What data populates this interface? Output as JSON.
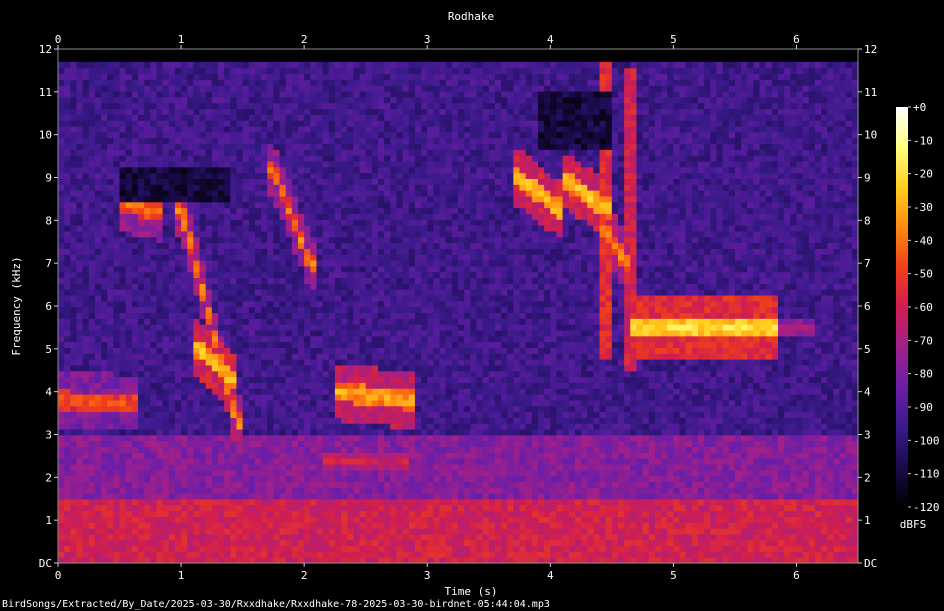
{
  "chart_data": {
    "type": "heatmap",
    "title": "Rodhake",
    "xlabel": "Time (s)",
    "ylabel": "Frequency (kHz)",
    "xlim": [
      0,
      6.5
    ],
    "ylim": [
      0,
      12
    ],
    "x_ticks": [
      "0",
      "1",
      "2",
      "3",
      "4",
      "5",
      "6"
    ],
    "y_ticks": [
      "DC",
      "1",
      "2",
      "3",
      "4",
      "5",
      "6",
      "7",
      "8",
      "9",
      "10",
      "11",
      "12"
    ],
    "colorbar": {
      "label": "dBFS",
      "range": [
        -120,
        0
      ],
      "ticks": [
        "+0",
        "-10",
        "-20",
        "-30",
        "-40",
        "-50",
        "-60",
        "-70",
        "-80",
        "-90",
        "-100",
        "-110",
        "-120"
      ]
    },
    "colormap": [
      "#000000",
      "#1a0a4a",
      "#3a1a8a",
      "#6a1ea8",
      "#a0208a",
      "#d01e50",
      "#f04018",
      "#ff8a10",
      "#ffd020",
      "#ffff80",
      "#ffffff"
    ],
    "background_level_db": -95,
    "low_freq_energy": [
      {
        "f0": 0,
        "f1": 1.5,
        "db": -60
      },
      {
        "f0": 1.5,
        "f1": 3.0,
        "db": -78
      }
    ],
    "features": [
      {
        "kind": "tone",
        "t0": 0.0,
        "t1": 0.6,
        "f0": 3.8,
        "f1": 3.75,
        "db": -45
      },
      {
        "kind": "sweep",
        "t0": 0.55,
        "t1": 0.8,
        "f0": 8.4,
        "f1": 8.2,
        "db": -40
      },
      {
        "kind": "sweep",
        "t0": 1.0,
        "t1": 1.45,
        "f0": 8.3,
        "f1": 3.3,
        "db": -35
      },
      {
        "kind": "sweep",
        "t0": 1.15,
        "t1": 1.4,
        "f0": 5.0,
        "f1": 4.3,
        "db": -25
      },
      {
        "kind": "sweep",
        "t0": 1.75,
        "t1": 2.05,
        "f0": 9.2,
        "f1": 7.0,
        "db": -40
      },
      {
        "kind": "sweep",
        "t0": 2.3,
        "t1": 2.85,
        "f0": 4.0,
        "f1": 3.8,
        "db": -30
      },
      {
        "kind": "sweep",
        "t0": 2.2,
        "t1": 2.8,
        "f0": 2.4,
        "f1": 2.4,
        "db": -60
      },
      {
        "kind": "sweep",
        "t0": 3.75,
        "t1": 4.05,
        "f0": 9.0,
        "f1": 8.3,
        "db": -25
      },
      {
        "kind": "sweep",
        "t0": 4.15,
        "t1": 4.45,
        "f0": 8.9,
        "f1": 8.3,
        "db": -25
      },
      {
        "kind": "sweep",
        "t0": 4.45,
        "t1": 4.62,
        "f0": 7.8,
        "f1": 7.0,
        "db": -35
      },
      {
        "kind": "vline",
        "t0": 4.45,
        "t1": 4.48,
        "f0": 4.7,
        "f1": 11.7,
        "db": -55
      },
      {
        "kind": "vline",
        "t0": 4.62,
        "t1": 4.65,
        "f0": 4.5,
        "f1": 11.5,
        "db": -60
      },
      {
        "kind": "trill",
        "t0": 4.7,
        "t1": 5.8,
        "f0": 5.5,
        "f1": 5.5,
        "db": -20
      },
      {
        "kind": "tone",
        "t0": 5.8,
        "t1": 6.1,
        "f0": 5.5,
        "f1": 5.5,
        "db": -70
      },
      {
        "kind": "dark",
        "t0": 0.5,
        "t1": 1.4,
        "f0": 8.5,
        "f1": 9.2,
        "db": -110
      },
      {
        "kind": "dark",
        "t0": 3.9,
        "t1": 4.5,
        "f0": 9.6,
        "f1": 11.0,
        "db": -110
      }
    ]
  },
  "footer": {
    "path": "BirdSongs/Extracted/By_Date/2025-03-30/Rxxdhake/Rxxdhake-78-2025-03-30-birdnet-05:44:04.mp3"
  }
}
